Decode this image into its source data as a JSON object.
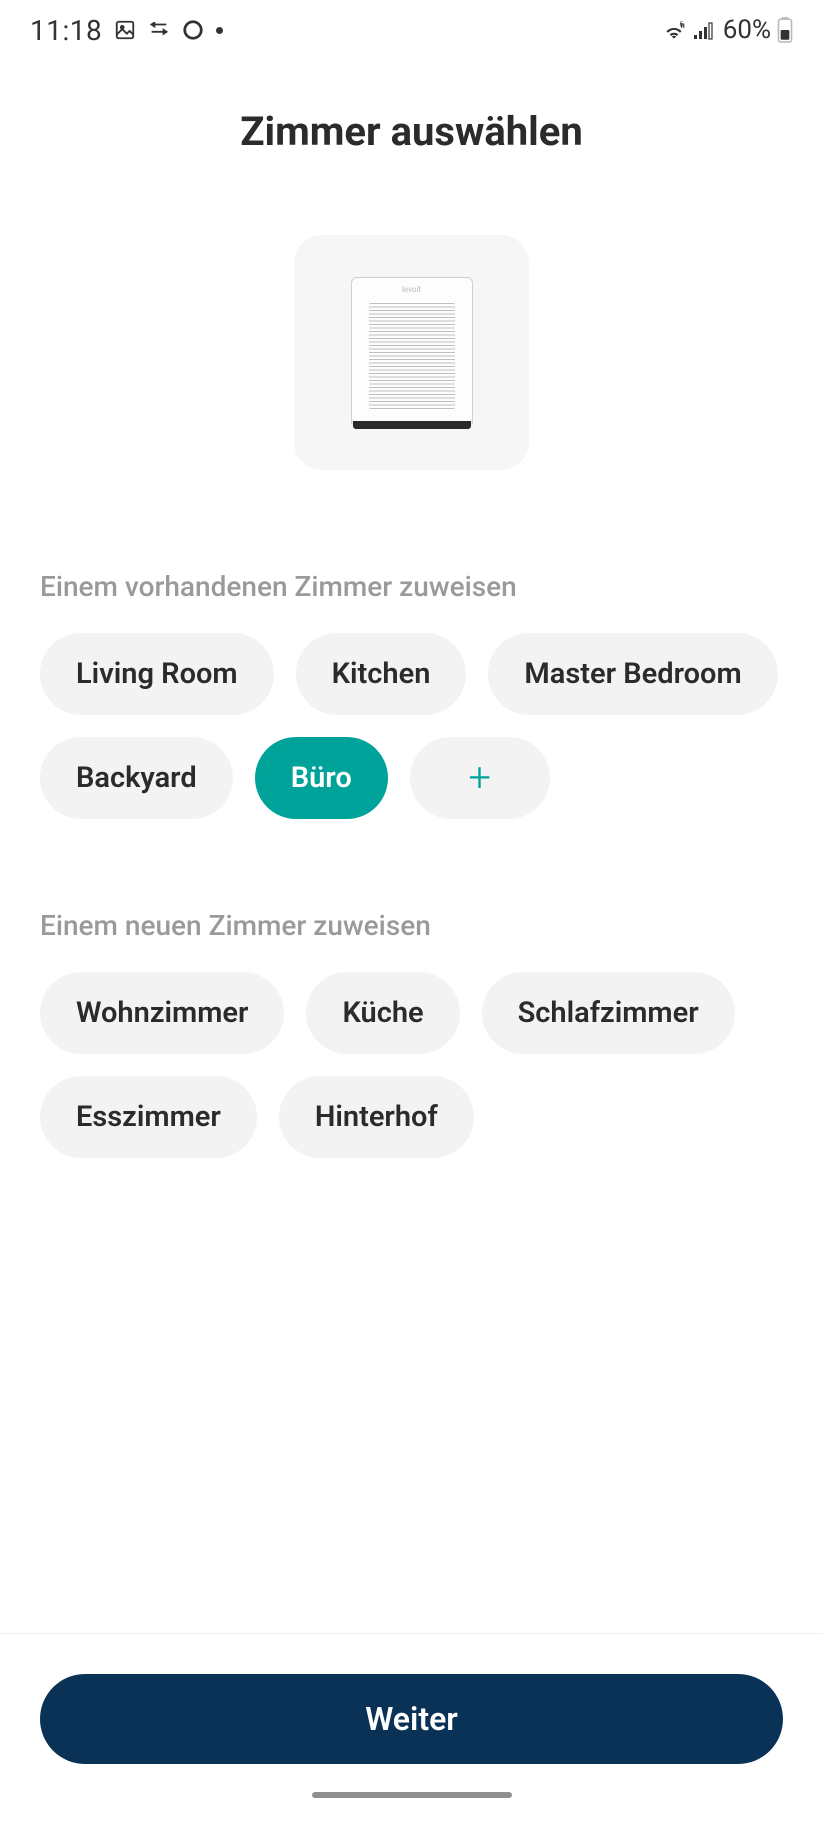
{
  "status_bar": {
    "time": "11:18",
    "battery_text": "60%"
  },
  "page": {
    "title": "Zimmer auswählen"
  },
  "existing": {
    "label": "Einem vorhandenen Zimmer zuweisen",
    "rooms": [
      {
        "label": "Living Room",
        "selected": false
      },
      {
        "label": "Kitchen",
        "selected": false
      },
      {
        "label": "Master Bedroom",
        "selected": false
      },
      {
        "label": "Backyard",
        "selected": false
      },
      {
        "label": "Büro",
        "selected": true
      }
    ]
  },
  "new_room": {
    "label": "Einem neuen Zimmer zuweisen",
    "rooms": [
      {
        "label": "Wohnzimmer"
      },
      {
        "label": "Küche"
      },
      {
        "label": "Schlafzimmer"
      },
      {
        "label": "Esszimmer"
      },
      {
        "label": "Hinterhof"
      }
    ]
  },
  "footer": {
    "continue_label": "Weiter"
  },
  "device": {
    "brand": "levoit"
  },
  "colors": {
    "accent": "#00a39a",
    "primary_button": "#0a3256"
  }
}
